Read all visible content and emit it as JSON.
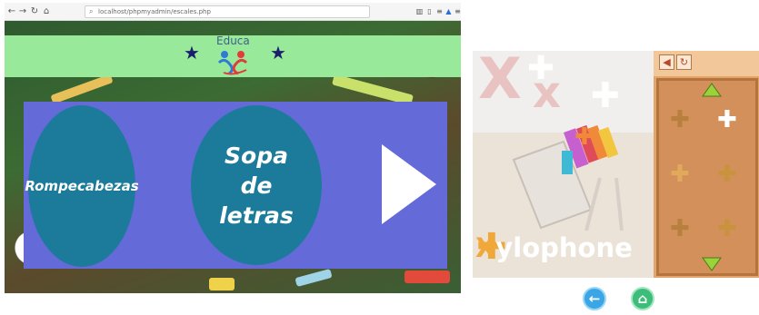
{
  "browser": {
    "url": "localhost/phpmyadmin/escales.php",
    "nav_icons": [
      "back-icon",
      "forward-icon",
      "reload-icon",
      "home-icon"
    ],
    "toolbar_icons": [
      "library-icon",
      "sidebar-icon",
      "reader-icon",
      "extension-icon",
      "menu-icon"
    ]
  },
  "educa_page": {
    "logo_text": "Educa",
    "header_color": "#98ea9a",
    "panel_color": "#646ad8",
    "circle_color": "#1c7b9a",
    "menu": [
      {
        "label": "Rompecabezas"
      },
      {
        "label": "Sopa de letras"
      }
    ],
    "next_icon": "play-arrow-icon"
  },
  "puzzle_game": {
    "word": "Xylophone",
    "word_first_letter": "X",
    "word_rest": "ylophone",
    "background_letters": "Xx",
    "tray_buttons": [
      "back-arrow-icon",
      "reset-icon"
    ],
    "tray_arrows": [
      "arrow-up-icon",
      "arrow-down-icon"
    ],
    "bottom_buttons": [
      {
        "icon": "arrow-left-icon",
        "glyph": "←"
      },
      {
        "icon": "home-icon",
        "glyph": "⌂"
      }
    ]
  }
}
